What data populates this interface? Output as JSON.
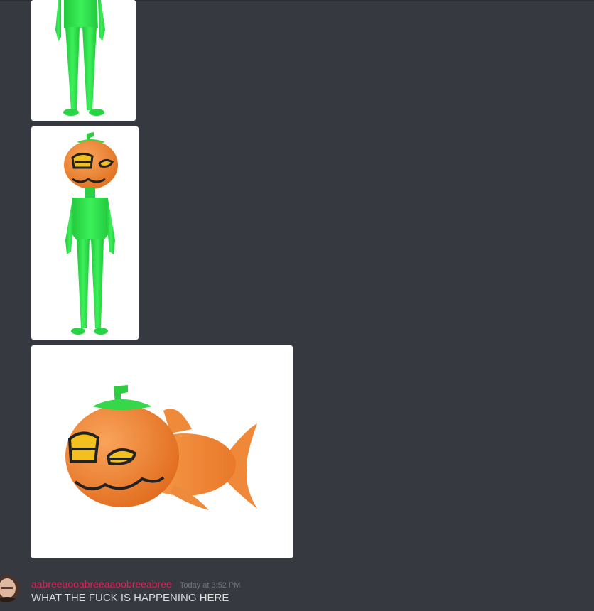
{
  "message": {
    "username": "aabreeaooabreeaaoobreeabree",
    "timestamp": "Today at 3:52 PM",
    "text": "WHAT THE FUCK IS HAPPENING HERE",
    "username_color": "#e0205a"
  },
  "attachments": [
    {
      "subject": "green-figure-legs"
    },
    {
      "subject": "pumpkin-head-green-figure"
    },
    {
      "subject": "pumpkin-head-goldfish"
    }
  ],
  "colors": {
    "background": "#36393f",
    "figure_green": "#2ee04a",
    "pumpkin_orange": "#f08a3a",
    "eye_yellow": "#f4c020"
  }
}
